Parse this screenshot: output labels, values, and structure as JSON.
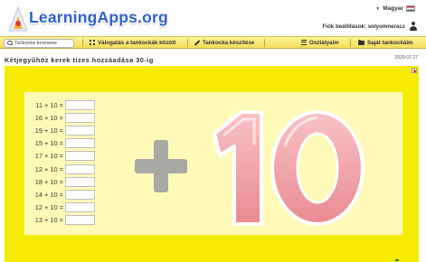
{
  "header": {
    "brand": "LearningApps.org",
    "language": "Magyar",
    "account_text": "Fiók beállítások: solyomneracz"
  },
  "navbar": {
    "search_placeholder": "Tankocka keresése",
    "items": [
      {
        "label": "Válogatás a tankockák között",
        "icon": "grid-icon"
      },
      {
        "label": "Tankocka készítése",
        "icon": "pencil-icon"
      },
      {
        "label": "Osztályaim",
        "icon": "list-icon"
      },
      {
        "label": "Saját tankockáim",
        "icon": "folder-icon"
      }
    ]
  },
  "page": {
    "title": "Kétjegyűhöz kerek tízes hozzáadása 30-ig",
    "date": "2020-07-27"
  },
  "app": {
    "graphic_text": "+10",
    "rows": [
      {
        "expression": "11 + 10 =",
        "value": ""
      },
      {
        "expression": "16 + 10 =",
        "value": ""
      },
      {
        "expression": "19 + 10 =",
        "value": ""
      },
      {
        "expression": "15 + 10 =",
        "value": ""
      },
      {
        "expression": "17 + 10 =",
        "value": ""
      },
      {
        "expression": "12 + 10 =",
        "value": ""
      },
      {
        "expression": "18 + 10 =",
        "value": ""
      },
      {
        "expression": "14 + 10 =",
        "value": ""
      },
      {
        "expression": "12 + 10 =",
        "value": ""
      },
      {
        "expression": "13 + 10 =",
        "value": ""
      }
    ]
  },
  "colors": {
    "app_background": "#f7ec00",
    "panel_background": "#fffab8",
    "navbar": "#f6e36a",
    "brand_blue": "#2f62c8",
    "digit_pink": "#f0a0a6"
  }
}
